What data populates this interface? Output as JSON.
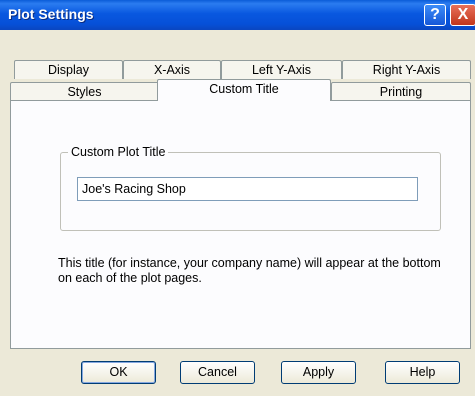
{
  "window": {
    "title": "Plot Settings",
    "help_glyph": "?",
    "close_glyph": "X"
  },
  "tabs": {
    "row_back": [
      "Display",
      "X-Axis",
      "Left Y-Axis",
      "Right Y-Axis"
    ],
    "row_front": [
      "Styles",
      "Custom Title",
      "Printing"
    ],
    "active": "Custom Title"
  },
  "custom_title": {
    "group_label": "Custom Plot Title",
    "value": "Joe's Racing Shop",
    "description": "This title (for instance, your company name) will appear at the bottom on each of the plot pages."
  },
  "buttons": {
    "ok": "OK",
    "cancel": "Cancel",
    "apply": "Apply",
    "help": "Help"
  }
}
